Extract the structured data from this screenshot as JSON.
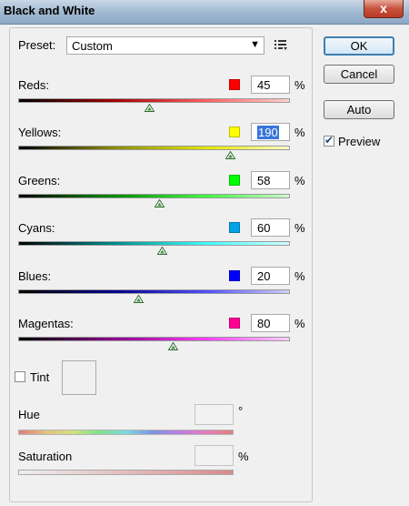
{
  "window": {
    "title": "Black and White",
    "close_glyph": "x"
  },
  "preset": {
    "label": "Preset:",
    "value": "Custom",
    "dropdown_icon": "chevron-down-icon",
    "menu_icon": "preset-menu-icon"
  },
  "buttons": {
    "ok": "OK",
    "cancel": "Cancel",
    "auto": "Auto"
  },
  "preview": {
    "label": "Preview",
    "checked": true
  },
  "channels": [
    {
      "key": "reds",
      "label": "Reds:",
      "value": "45",
      "swatch": "#ff0000",
      "grad": "linear-gradient(90deg,#000,#a00000 35%,#ff6060 70%,#ffd0d0)",
      "thumb": 0.48
    },
    {
      "key": "yellows",
      "label": "Yellows:",
      "value": "190",
      "swatch": "#ffff00",
      "grad": "linear-gradient(90deg,#000,#8a8a00 35%,#e6e600 70%,#ffffc8)",
      "thumb": 0.78,
      "selected": true
    },
    {
      "key": "greens",
      "label": "Greens:",
      "value": "58",
      "swatch": "#00ff00",
      "grad": "linear-gradient(90deg,#000,#008a00 35%,#40ff40 70%,#d0ffd0)",
      "thumb": 0.52
    },
    {
      "key": "cyans",
      "label": "Cyans:",
      "value": "60",
      "swatch": "#00a2e8",
      "grad": "linear-gradient(90deg,#000,#008a8a 35%,#40ffff 70%,#d0ffff)",
      "thumb": 0.53
    },
    {
      "key": "blues",
      "label": "Blues:",
      "value": "20",
      "swatch": "#0000ff",
      "grad": "linear-gradient(90deg,#000,#00008a 35%,#5050ff 70%,#d0d0ff)",
      "thumb": 0.44
    },
    {
      "key": "magentas",
      "label": "Magentas:",
      "value": "80",
      "swatch": "#ff0090",
      "grad": "linear-gradient(90deg,#000,#8a008a 35%,#ff40ff 70%,#ffd0ff)",
      "thumb": 0.57
    }
  ],
  "percent_sign": "%",
  "tint": {
    "label": "Tint",
    "checked": false
  },
  "hue": {
    "label": "Hue",
    "unit": "°"
  },
  "saturation": {
    "label": "Saturation",
    "unit": "%"
  }
}
